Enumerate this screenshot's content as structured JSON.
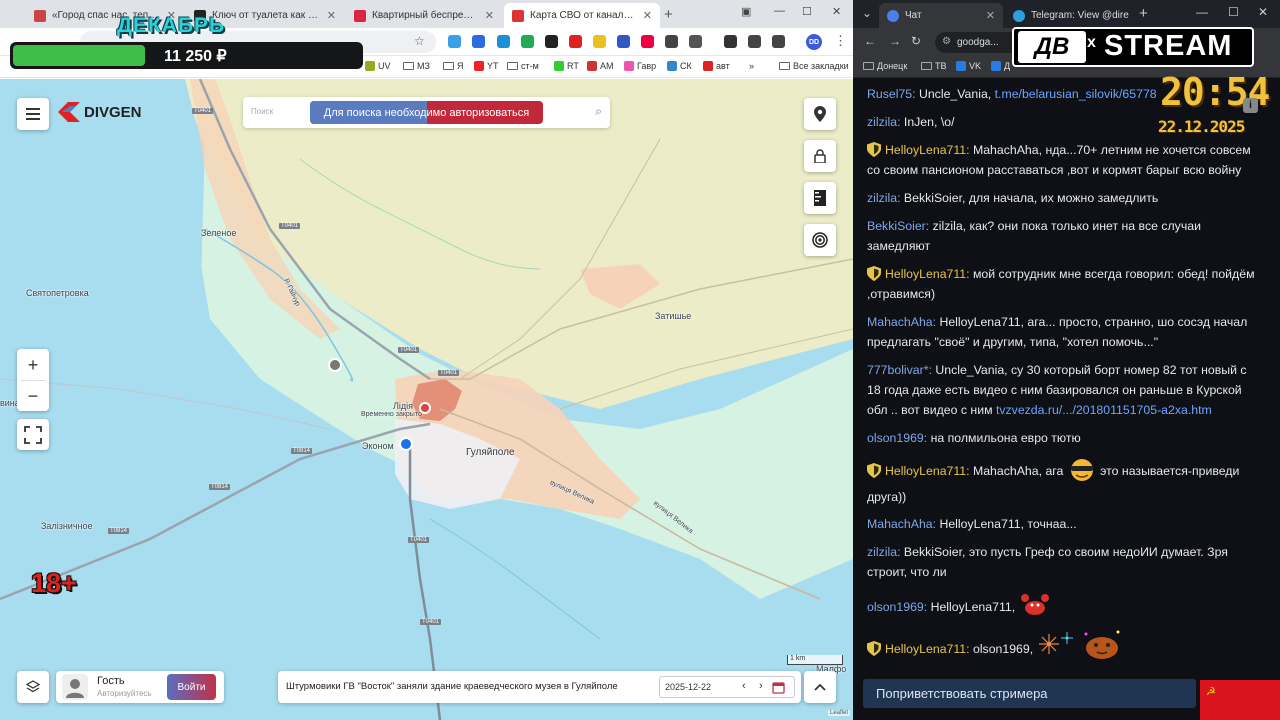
{
  "left_browser": {
    "tabs": [
      {
        "title": "«Город спас нас, теперь мы б"
      },
      {
        "title": "Ключ от туалета как культурн"
      },
      {
        "title": "Квартирный беспредел - под"
      },
      {
        "title": "Карта СВО от канала DIVGEN"
      }
    ],
    "window_controls": {
      "minimize": "—",
      "maximize": "☐",
      "close": "✕"
    },
    "profile": "DD",
    "bookmarks": [
      "UV",
      "МЗ",
      "Я",
      "YT",
      "ст-м",
      "RT",
      "AM",
      "Гавр",
      "СК",
      "авт",
      "»",
      "Все закладки"
    ],
    "new_tab": "+"
  },
  "overlay": {
    "month": "ДЕКАБРЬ",
    "amount": "11 250 ₽",
    "progress_fraction": 0.38,
    "age_rating": "18+"
  },
  "map": {
    "brand": "DIVGEN",
    "search_placeholder": "Поиск",
    "auth_button": "Для поиска необходимо авторизоваться",
    "zoom_in": "+",
    "zoom_out": "−",
    "places": {
      "zelenoe": "Зеленое",
      "svyatopetrovka": "Святопетровка",
      "zatyshe": "Затишье",
      "lidiya": "Лідія",
      "vremenno": "Временно закрыто",
      "ekonom": "Эконом",
      "gulyaipole": "Гуляйполе",
      "zaliznichnoe": "Залізничное",
      "vina": "вина",
      "mafo": "Малфо",
      "street1": "вулиця Велика",
      "street2": "вулиця Велика",
      "roadname": "Р. Гайчур"
    },
    "roads": {
      "t0401a": "T0401",
      "t0401b": "T0401",
      "t0401c": "T0401",
      "t0401d": "T0401",
      "t0401e": "T0401",
      "t0401f": "T0401",
      "t0814a": "T0814",
      "t0814b": "T0814",
      "t0814c": "T0814"
    },
    "guest_name": "Гость",
    "guest_status": "Авторизуйтесь",
    "login_button": "Войти",
    "news_headline": "Штурмовики ГВ \"Восток\" заняли здание краеведческого музея в Гуляйполе",
    "date": "2025-12-22",
    "scale": "1 km",
    "attribution": "Leaflet"
  },
  "right_browser": {
    "tabs": [
      {
        "title": "Чат"
      },
      {
        "title": "Telegram: View @dire"
      }
    ],
    "url": "goodga...",
    "bookmarks": [
      "Донецк",
      "ТВ",
      "VK",
      "Д"
    ]
  },
  "stream": {
    "logo_left": "ДВ",
    "logo_x": "x",
    "logo_right": "STREAM",
    "time": "20:54",
    "date": "22.12.2025"
  },
  "chat": {
    "messages": [
      {
        "nick": "Rusel75:",
        "text": " Uncle_Vania, ",
        "link": "t.me/belarusian_silovik/65778"
      },
      {
        "nick": "zilzila:",
        "text": " InJen, \\o/"
      },
      {
        "nick": "HelloyLena711:",
        "text": " MahachAha, нда...70+ летним не хочется совсем со своим пансионом расставаться ,вот и кормят барыг всю войну"
      },
      {
        "nick": "zilzila:",
        "text": " BekkiSoier, для начала, их можно замедлить"
      },
      {
        "nick": "BekkiSoier:",
        "text": " zilzila, как? они пока только инет на все случаи замедляют"
      },
      {
        "nick": "HelloyLena711:",
        "text": " мой сотрудник мне всегда говорил: обед! пойдём ,отравимся)"
      },
      {
        "nick": "MahachAha:",
        "text": " HelloyLena711, ага... просто, странно, шо сосэд начал предлагать \"своё\" и другим, типа, \"хотел помочь...\""
      },
      {
        "nick": "777bolivar*:",
        "text": " Uncle_Vania, су 30 который борт номер 82 тот новый с 18 года даже есть видео с ним базировался он раньше в Курской обл .. вот видео с ним ",
        "link": "tvzvezda.ru/.../201801151705-a2xa.htm"
      },
      {
        "nick": "olson1969:",
        "text": " на полмильона евро тютю"
      },
      {
        "nick": "HelloyLena711:",
        "text": " MahachAha, ага",
        "text2": " это называется-приведи друга))"
      },
      {
        "nick": "MahachAha:",
        "text": " HelloyLena711, точнаа..."
      },
      {
        "nick": "zilzila:",
        "text": " BekkiSoier, это пусть Греф со своим недоИИ думает. Зря строит, что ли"
      },
      {
        "nick": "olson1969:",
        "text": " HelloyLena711,"
      },
      {
        "nick": "HelloyLena711:",
        "text": " olson1969,"
      }
    ],
    "greet_button": "Поприветствовать стримера",
    "info_badge": "i"
  },
  "colors": {
    "map_water": "#a8dcef",
    "map_land": "#ecedc8",
    "map_town": "#f6d3b8",
    "gold": "#e6c44a",
    "nick_blue": "#7fa7e6"
  }
}
